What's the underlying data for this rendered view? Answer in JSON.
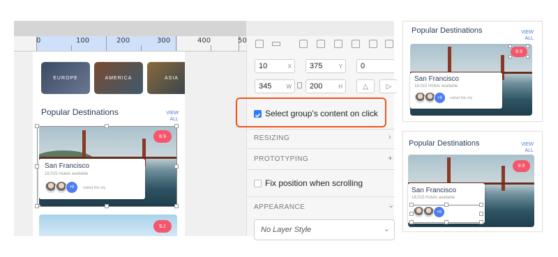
{
  "ruler": {
    "ticks": [
      "0",
      "100",
      "200",
      "300",
      "400",
      "50"
    ]
  },
  "regions": [
    "EUROPE",
    "AMERICA",
    "ASIA"
  ],
  "card": {
    "section_title": "Popular Destinations",
    "view": "VIEW",
    "all": "ALL",
    "city": "San Francisco",
    "hotels": "18,015 Hotels available",
    "visited": "visited this city",
    "more": "+8",
    "rating": "8.9",
    "second_rating": "9.2"
  },
  "inspector": {
    "x": {
      "value": "10",
      "label": "X"
    },
    "y": {
      "value": "375",
      "label": "Y"
    },
    "rotation": {
      "value": "0"
    },
    "width": {
      "value": "345",
      "label": "W"
    },
    "height": {
      "value": "200",
      "label": "H"
    },
    "select_group_label": "Select group’s content on click",
    "select_group_checked": true,
    "resizing": "RESIZING",
    "prototyping": "PROTOTYPING",
    "fix_position_label": "Fix position when scrolling",
    "appearance": "APPEARANCE",
    "layer_style": "No Layer Style"
  },
  "colors": {
    "highlight": "#f0541b",
    "checkbox": "#2f7cf6",
    "rating": "#f5566b",
    "accent": "#4a78d8"
  }
}
